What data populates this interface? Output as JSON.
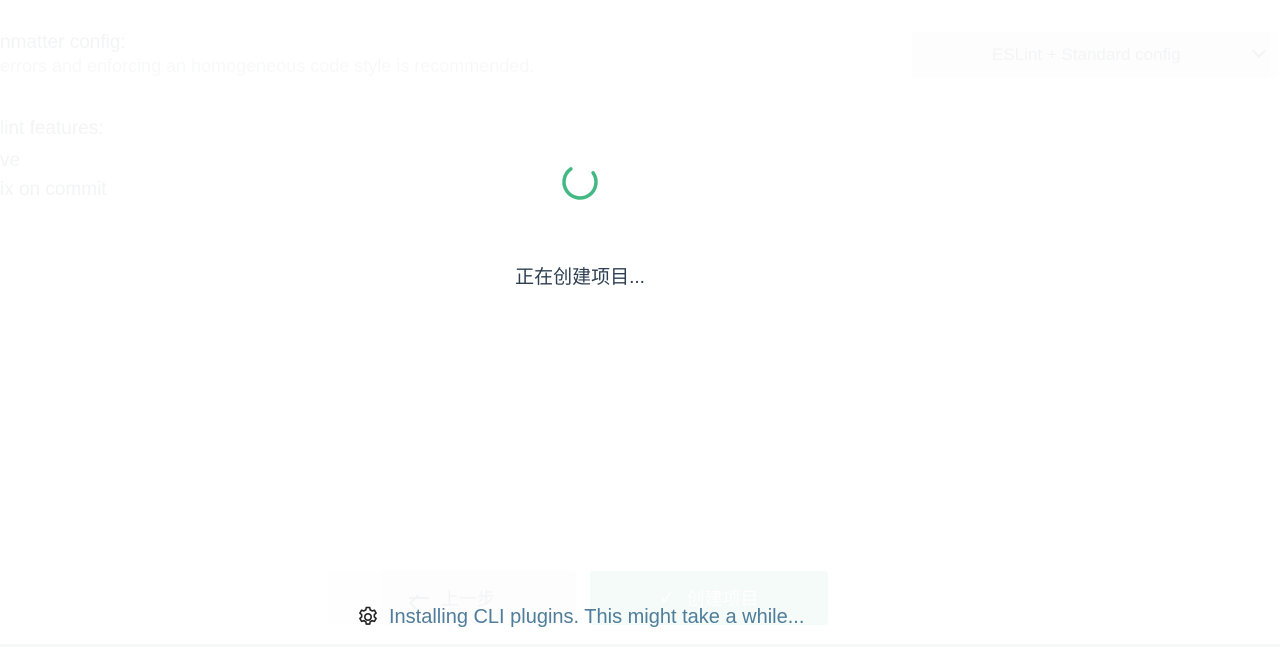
{
  "background_form": {
    "formatter_label": "nmatter config:",
    "formatter_description": "errors and enforcing an homogeneous code style is recommended.",
    "lint_features_label": "lint features:",
    "lint_option_save": "ve",
    "lint_option_commit": "ix on commit",
    "formatter_select_value": "ESLint + Standard config",
    "previous_button_label": "上一步",
    "create_button_label": "创建项目",
    "create_button_icon": "check-icon",
    "previous_button_icon": "arrow-left-icon"
  },
  "loading": {
    "title": "正在创建项目...",
    "status": "Installing CLI plugins. This might take a while...",
    "status_icon": "gear-icon",
    "spinner_icon": "spinner-icon"
  },
  "colors": {
    "accent": "#42b983",
    "text": "#2c3e50",
    "status_text": "#4f7d9a"
  }
}
